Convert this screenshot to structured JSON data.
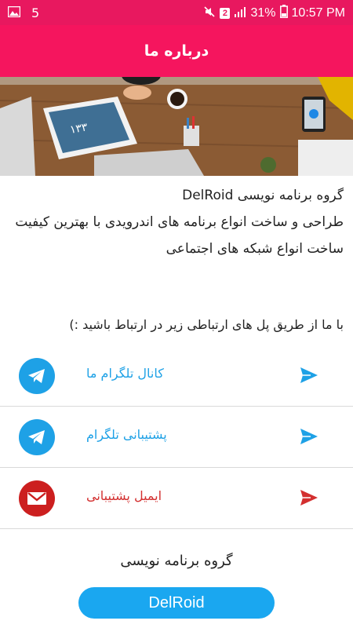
{
  "status_bar": {
    "notif_count": "5",
    "sim_badge": "2",
    "battery": "31%",
    "time": "10:57 PM"
  },
  "app_bar": {
    "title": "درباره ما"
  },
  "about": {
    "line1": "گروه برنامه نویسی DelRoid",
    "line2": "طراحی و ساخت انواع برنامه های اندرویدی با بهترین کیفیت",
    "line3": "ساخت انواع شبکه های اجتماعی"
  },
  "contact_intro": "با ما از طریق پل های ارتباطی زیر در ارتباط باشید :)",
  "contacts": [
    {
      "label": "کانال تلگرام ما",
      "icon": "telegram-icon",
      "color": "#1ea1e6"
    },
    {
      "label": "پشتیبانی تلگرام",
      "icon": "telegram-icon",
      "color": "#1ea1e6"
    },
    {
      "label": "ایمیل پشتیبانی",
      "icon": "email-icon",
      "color": "#d32f2f"
    }
  ],
  "footer": {
    "title": "گروه برنامه نویسی",
    "brand_button": "DelRoid"
  },
  "colors": {
    "primary": "#f5155e",
    "status_bar": "#e8185f",
    "telegram": "#1ea1e6",
    "email": "#d32f2f",
    "brand_button": "#1aa7f0"
  }
}
